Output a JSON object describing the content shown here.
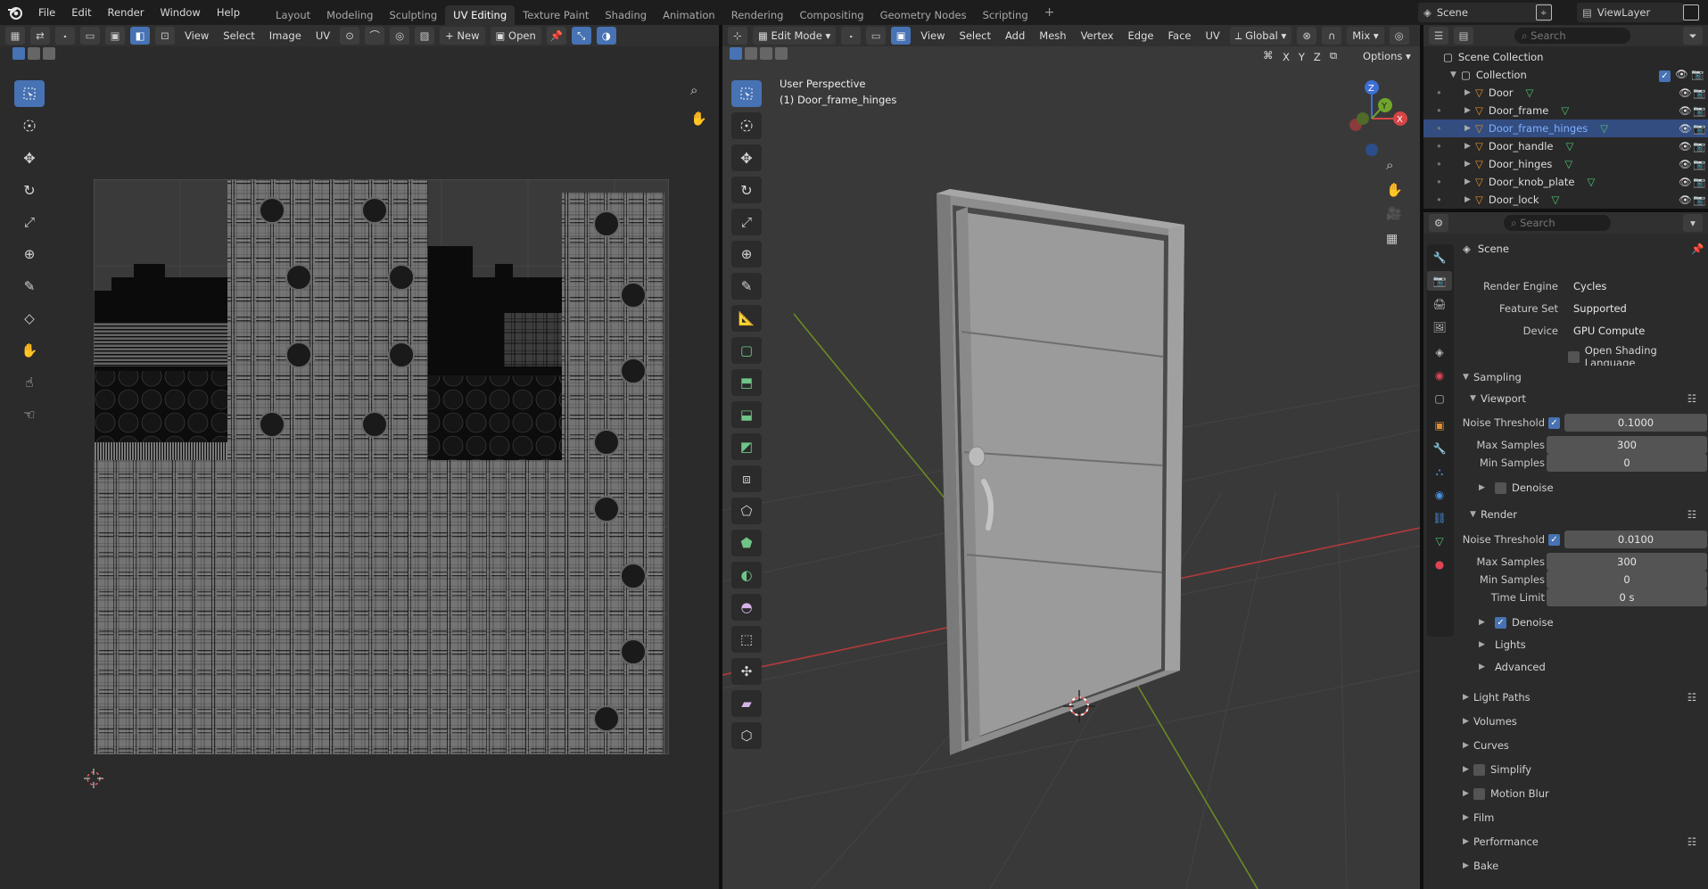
{
  "colors": {
    "accent": "#4772b3",
    "selection": "#334d80",
    "highlight_text": "#7fb0ff",
    "mesh_icon": "#4ec46f",
    "object_icon": "#e58e2e"
  },
  "menu": [
    "File",
    "Edit",
    "Render",
    "Window",
    "Help"
  ],
  "workspaces": [
    "Layout",
    "Modeling",
    "Sculpting",
    "UV Editing",
    "Texture Paint",
    "Shading",
    "Animation",
    "Rendering",
    "Compositing",
    "Geometry Nodes",
    "Scripting"
  ],
  "active_workspace": "UV Editing",
  "scene": {
    "name": "Scene",
    "view_layer": "ViewLayer"
  },
  "uv_editor": {
    "menus": [
      "View",
      "Select",
      "Image",
      "UV"
    ],
    "new_label": "New",
    "open_label": "Open"
  },
  "viewport": {
    "mode": "Edit Mode",
    "menus": [
      "View",
      "Select",
      "Add",
      "Mesh",
      "Vertex",
      "Edge",
      "Face",
      "UV"
    ],
    "orientation": "Global",
    "mix_label": "Mix",
    "options_label": "Options",
    "axes": [
      "X",
      "Y",
      "Z"
    ],
    "perspective": "User Perspective",
    "object_label": "(1) Door_frame_hinges"
  },
  "outliner": {
    "search_placeholder": "Search",
    "root": "Scene Collection",
    "collection": "Collection",
    "items": [
      "Door",
      "Door_frame",
      "Door_frame_hinges",
      "Door_handle",
      "Door_hinges",
      "Door_knob_plate",
      "Door_lock"
    ],
    "selected": "Door_frame_hinges"
  },
  "properties": {
    "search_placeholder": "Search",
    "context": "Scene",
    "render_engine": {
      "label": "Render Engine",
      "value": "Cycles"
    },
    "feature_set": {
      "label": "Feature Set",
      "value": "Supported"
    },
    "device": {
      "label": "Device",
      "value": "GPU Compute"
    },
    "osl": "Open Shading Language",
    "sampling": "Sampling",
    "viewport": {
      "title": "Viewport",
      "noise_threshold": {
        "label": "Noise Threshold",
        "value": "0.1000"
      },
      "max_samples": {
        "label": "Max Samples",
        "value": "300"
      },
      "min_samples": {
        "label": "Min Samples",
        "value": "0"
      },
      "denoise": "Denoise"
    },
    "render": {
      "title": "Render",
      "noise_threshold": {
        "label": "Noise Threshold",
        "value": "0.0100"
      },
      "max_samples": {
        "label": "Max Samples",
        "value": "300"
      },
      "min_samples": {
        "label": "Min Samples",
        "value": "0"
      },
      "time_limit": {
        "label": "Time Limit",
        "value": "0 s"
      },
      "denoise": "Denoise",
      "lights": "Lights",
      "advanced": "Advanced"
    },
    "panels": [
      "Light Paths",
      "Volumes",
      "Curves",
      "Simplify",
      "Motion Blur",
      "Film",
      "Performance",
      "Bake"
    ]
  }
}
